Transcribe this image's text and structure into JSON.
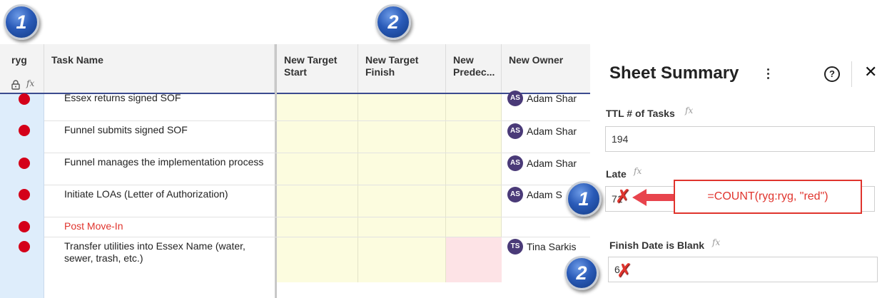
{
  "columns": {
    "ryg": "ryg",
    "task_name": "Task Name",
    "new_target_start": "New Target Start",
    "new_target_finish": "New Target Finish",
    "new_predecessors": "New Predec...",
    "new_owner": "New Owner"
  },
  "rows": [
    {
      "status": "red",
      "task": "Essex returns signed SOF",
      "owner_initials": "AS",
      "owner_name": "Adam Shar"
    },
    {
      "status": "red",
      "task": "Funnel submits signed SOF",
      "owner_initials": "AS",
      "owner_name": "Adam Shar"
    },
    {
      "status": "red",
      "task": "Funnel manages the implementation process",
      "owner_initials": "AS",
      "owner_name": "Adam Shar"
    },
    {
      "status": "red",
      "task": "Initiate LOAs (Letter of Authorization)",
      "owner_initials": "AS",
      "owner_name": "Adam S"
    },
    {
      "status": "red",
      "task": "Post Move-In",
      "owner_initials": "",
      "owner_name": ""
    },
    {
      "status": "red",
      "task": "Transfer utilities into Essex Name (water, sewer, trash, etc.)",
      "owner_initials": "TS",
      "owner_name": "Tina Sarkis"
    }
  ],
  "summary": {
    "title": "Sheet Summary",
    "help_glyph": "?",
    "close_glyph": "✕",
    "fields": [
      {
        "label": "TTL # of Tasks",
        "value": "194"
      },
      {
        "label": "Late",
        "value": "71"
      },
      {
        "label": "Finish Date is Blank",
        "value": "6"
      }
    ]
  },
  "annotation": {
    "badge_1": "1",
    "badge_2": "2",
    "formula": "=COUNT(ryg:ryg, \"red\")",
    "x_mark": "✗"
  },
  "colors": {
    "status_red": "#d40019",
    "highlight_text_red": "#e0342d",
    "avatar_purple": "#4a3a78",
    "header_divider": "#3b4b8f"
  },
  "icons": {
    "lock": "lock-icon",
    "formula": "fx-icon",
    "kebab": "more-vertical-icon",
    "help": "help-circle-icon",
    "close": "close-icon"
  }
}
